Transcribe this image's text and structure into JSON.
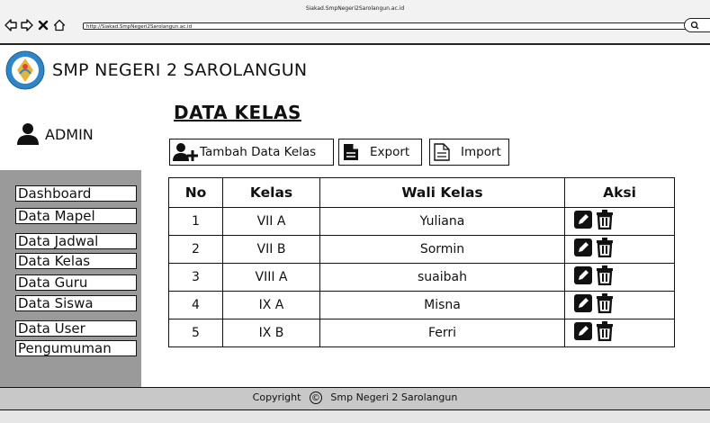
{
  "browser": {
    "window_title": "Siakad.SmpNegeri2Sarolangun.ac.id",
    "url": "http://Siakad.SmpNegeri2Sarolangun.ac.id"
  },
  "header": {
    "school_name": "SMP NEGERI 2 SAROLANGUN"
  },
  "user": {
    "name": "ADMIN"
  },
  "sidebar": {
    "items": [
      {
        "label": "Dashboard"
      },
      {
        "label": "Data Mapel"
      },
      {
        "label": "Data Jadwal"
      },
      {
        "label": "Data Kelas"
      },
      {
        "label": "Data Guru"
      },
      {
        "label": "Data Siswa"
      },
      {
        "label": "Data User"
      },
      {
        "label": "Pengumuman"
      }
    ]
  },
  "main": {
    "title": "DATA KELAS",
    "toolbar": {
      "add_label": "Tambah Data Kelas",
      "export_label": "Export",
      "import_label": "Import"
    },
    "table": {
      "headers": [
        "No",
        "Kelas",
        "Wali Kelas",
        "Aksi"
      ],
      "rows": [
        {
          "no": "1",
          "kelas": "VII A",
          "wali": "Yuliana"
        },
        {
          "no": "2",
          "kelas": "VII B",
          "wali": "Sormin"
        },
        {
          "no": "3",
          "kelas": "VIII A",
          "wali": "suaibah"
        },
        {
          "no": "4",
          "kelas": "IX A",
          "wali": "Misna"
        },
        {
          "no": "5",
          "kelas": "IX B",
          "wali": "Ferri"
        }
      ]
    }
  },
  "footer": {
    "copyright_label": "Copyright",
    "symbol": "©",
    "text": "Smp Negeri 2 Sarolangun"
  },
  "icons": {
    "back": "back-arrow-icon",
    "forward": "forward-arrow-icon",
    "close": "close-icon",
    "home": "home-icon",
    "search": "search-icon",
    "logo": "tut-wuri-handayani-logo",
    "user": "user-icon",
    "add_user": "add-user-icon",
    "export": "document-icon",
    "import": "document-icon",
    "edit": "pencil-icon",
    "delete": "trash-icon"
  },
  "colors": {
    "sidebar": "#9a9a9a",
    "footer": "#c8c8c8",
    "logo_blue": "#2e86c9",
    "logo_gold": "#e5b53a"
  }
}
